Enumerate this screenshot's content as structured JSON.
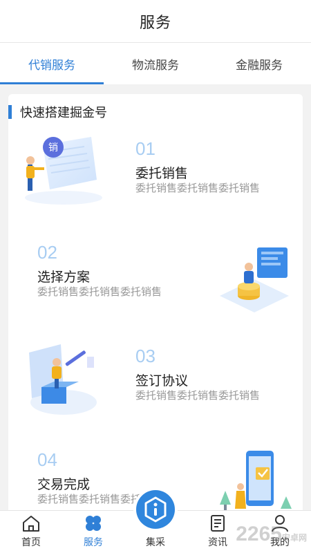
{
  "header": {
    "title": "服务"
  },
  "tabs": [
    {
      "label": "代销服务",
      "active": true
    },
    {
      "label": "物流服务",
      "active": false
    },
    {
      "label": "金融服务",
      "active": false
    }
  ],
  "section": {
    "title": "快速搭建掘金号"
  },
  "steps": [
    {
      "num": "01",
      "name": "委托销售",
      "desc": "委托销售委托销售委托销售"
    },
    {
      "num": "02",
      "name": "选择方案",
      "desc": "委托销售委托销售委托销售"
    },
    {
      "num": "03",
      "name": "签订协议",
      "desc": "委托销售委托销售委托销售"
    },
    {
      "num": "04",
      "name": "交易完成",
      "desc": "委托销售委托销售委托销售"
    }
  ],
  "illustration_badge": "销",
  "nav": [
    {
      "label": "首页",
      "icon": "home-icon",
      "active": false
    },
    {
      "label": "服务",
      "icon": "clover-icon",
      "active": true
    },
    {
      "label": "集采",
      "icon": "hexagon-info-icon",
      "active": false
    },
    {
      "label": "资讯",
      "icon": "news-icon",
      "active": false
    },
    {
      "label": "我的",
      "icon": "user-icon",
      "active": false
    }
  ],
  "watermark": {
    "text": "2265",
    "sub": "安卓网"
  },
  "colors": {
    "accent": "#2f7fd6",
    "step_number": "#a8cdf2",
    "muted_text": "#999999"
  }
}
